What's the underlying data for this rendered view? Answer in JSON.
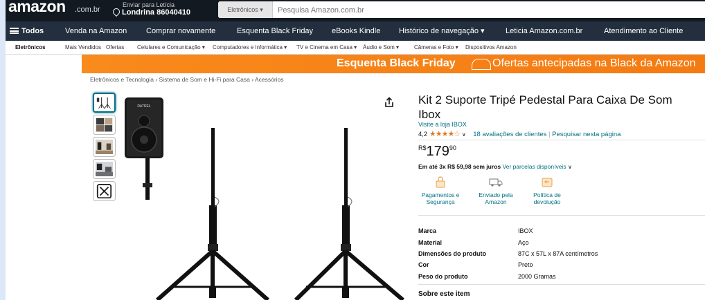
{
  "header": {
    "logo": "amazon",
    "logo_suffix": ".com.br",
    "deliver_line1": "Enviar para Letícia",
    "deliver_line2": "Londrina 86040410",
    "search_category": "Eletrônicos ▾",
    "search_placeholder": "Pesquisa Amazon.com.br"
  },
  "nav": {
    "all": "Todos",
    "items": [
      "Venda na Amazon",
      "Comprar novamente",
      "Esquenta Black Friday",
      "eBooks Kindle",
      "Histórico de navegação ▾",
      "Leticia Amazon.com.br",
      "Atendimento ao Cliente"
    ]
  },
  "subnav": {
    "items": [
      "Eletrônicos",
      "Mais Vendidos",
      "Ofertas",
      "Celulares e Comunicação ▾",
      "Computadores e Informática ▾",
      "TV e Cinema em Casa ▾",
      "Áudio e Som ▾",
      "Câmeras e Foto ▾",
      "Dispositivos Amazon"
    ]
  },
  "banner": {
    "strong": "Esquenta Black Friday",
    "rest": "Ofertas antecipadas na Black da Amazon"
  },
  "breadcrumb": "Eletrônicos e Tecnologia › Sistema de Som e Hi-Fi para Casa › Acessórios",
  "speaker_brand": "DATREL",
  "product": {
    "title_line1": "Kit 2 Suporte Tripé Pedestal Para Caixa De Som",
    "title_line2": "Ibox",
    "store_link": "Visite a loja IBOX",
    "rating": "4,2",
    "stars": "★★★★☆",
    "reviews": "18 avaliações de clientes",
    "separator": "|",
    "search_page": "Pesquisar nesta página",
    "price_currency": "R$",
    "price_int": "179",
    "price_cents": "90",
    "installments_bold": "Em até 3x R$ 59,98 sem juros",
    "installments_link": "Ver parcelas disponíveis",
    "features": [
      {
        "line1": "Pagamentos e",
        "line2": "Segurança"
      },
      {
        "line1": "Enviado pela",
        "line2": "Amazon"
      },
      {
        "line1": "Política de",
        "line2": "devolução"
      }
    ],
    "specs": [
      {
        "k": "Marca",
        "v": "IBOX"
      },
      {
        "k": "Material",
        "v": "Aço"
      },
      {
        "k": "Dimensões do produto",
        "v": "87C x 57L x 87A centímetros"
      },
      {
        "k": "Cor",
        "v": "Preto"
      },
      {
        "k": "Peso do produto",
        "v": "2000 Gramas"
      }
    ],
    "about_heading": "Sobre este item"
  },
  "colors": {
    "header_bg": "#131921",
    "nav_bg": "#232f3e",
    "banner": "#f47b12",
    "link": "#007185",
    "stars": "#de7921"
  }
}
